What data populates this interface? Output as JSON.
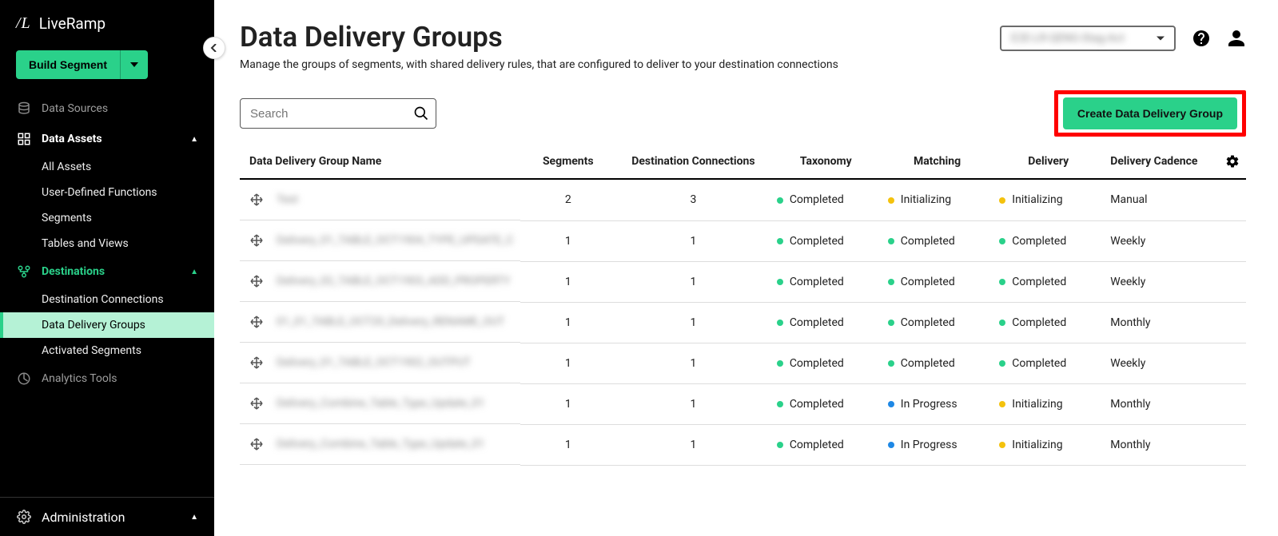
{
  "brand": {
    "mark": "/L",
    "name": "LiveRamp"
  },
  "sidebar": {
    "build_label": "Build Segment",
    "items": {
      "data_sources": "Data Sources",
      "data_assets": "Data Assets",
      "destinations": "Destinations",
      "analytics": "Analytics Tools",
      "admin": "Administration"
    },
    "data_assets_sub": [
      "All Assets",
      "User-Defined Functions",
      "Segments",
      "Tables and Views"
    ],
    "destinations_sub": [
      "Destination Connections",
      "Data Delivery Groups",
      "Activated Segments"
    ]
  },
  "header": {
    "title": "Data Delivery Groups",
    "description": "Manage the groups of segments, with shared delivery rules, that are configured to deliver to your destination connections",
    "account_value": "E2E-LR-QENG-Stag-Act"
  },
  "toolbar": {
    "search_placeholder": "Search",
    "create_label": "Create Data Delivery Group"
  },
  "table": {
    "headers": {
      "name": "Data Delivery Group Name",
      "segments": "Segments",
      "dest": "Destination Connections",
      "taxonomy": "Taxonomy",
      "matching": "Matching",
      "delivery": "Delivery",
      "cadence": "Delivery Cadence"
    },
    "rows": [
      {
        "name": "Test",
        "segments": "2",
        "dest": "3",
        "tax": {
          "c": "green",
          "t": "Completed"
        },
        "match": {
          "c": "yellow",
          "t": "Initializing"
        },
        "del": {
          "c": "yellow",
          "t": "Initializing"
        },
        "cad": "Manual"
      },
      {
        "name": "Delivery_01_TABLE_OCT1904_TYPE_UPDATE_C",
        "segments": "1",
        "dest": "1",
        "tax": {
          "c": "green",
          "t": "Completed"
        },
        "match": {
          "c": "green",
          "t": "Completed"
        },
        "del": {
          "c": "green",
          "t": "Completed"
        },
        "cad": "Weekly"
      },
      {
        "name": "Delivery_02_TABLE_OCT1903_ADD_PROPERTY",
        "segments": "1",
        "dest": "1",
        "tax": {
          "c": "green",
          "t": "Completed"
        },
        "match": {
          "c": "green",
          "t": "Completed"
        },
        "del": {
          "c": "green",
          "t": "Completed"
        },
        "cad": "Weekly"
      },
      {
        "name": "01_01_TABLE_OCT20_Delivery_RENAME_OUT",
        "segments": "1",
        "dest": "1",
        "tax": {
          "c": "green",
          "t": "Completed"
        },
        "match": {
          "c": "green",
          "t": "Completed"
        },
        "del": {
          "c": "green",
          "t": "Completed"
        },
        "cad": "Monthly"
      },
      {
        "name": "Delivery_01_TABLE_OCT1902_OUTPUT",
        "segments": "1",
        "dest": "1",
        "tax": {
          "c": "green",
          "t": "Completed"
        },
        "match": {
          "c": "green",
          "t": "Completed"
        },
        "del": {
          "c": "green",
          "t": "Completed"
        },
        "cad": "Weekly"
      },
      {
        "name": "Delivery_Combine_Table_Type_Update_01",
        "segments": "1",
        "dest": "1",
        "tax": {
          "c": "green",
          "t": "Completed"
        },
        "match": {
          "c": "blue",
          "t": "In Progress"
        },
        "del": {
          "c": "yellow",
          "t": "Initializing"
        },
        "cad": "Monthly"
      },
      {
        "name": "Delivery_Combine_Table_Type_Update_01",
        "segments": "1",
        "dest": "1",
        "tax": {
          "c": "green",
          "t": "Completed"
        },
        "match": {
          "c": "blue",
          "t": "In Progress"
        },
        "del": {
          "c": "yellow",
          "t": "Initializing"
        },
        "cad": "Monthly"
      }
    ]
  }
}
